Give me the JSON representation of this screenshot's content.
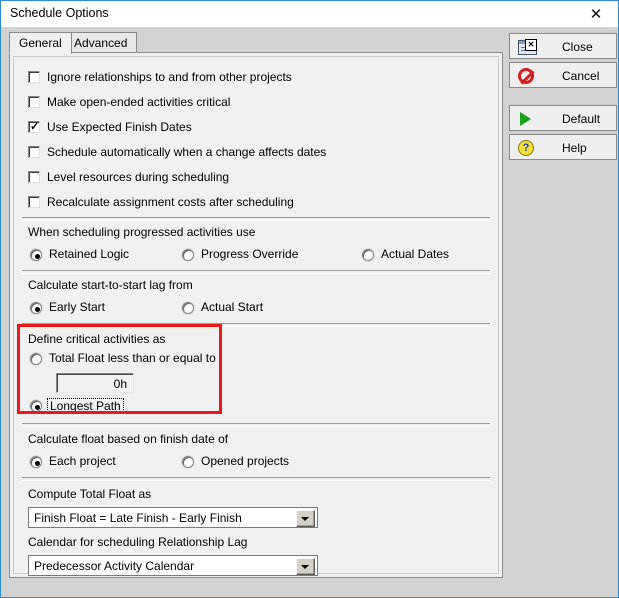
{
  "window": {
    "title": "Schedule Options",
    "close_icon": "close-icon"
  },
  "tabs": [
    {
      "label": "General",
      "active": true
    },
    {
      "label": "Advanced",
      "active": false
    }
  ],
  "checkboxes": [
    {
      "label": "Ignore relationships to and from other projects",
      "checked": false
    },
    {
      "label": "Make open-ended activities critical",
      "checked": false
    },
    {
      "label": "Use Expected Finish Dates",
      "checked": true
    },
    {
      "label": "Schedule automatically when a change affects dates",
      "checked": false
    },
    {
      "label": "Level resources during scheduling",
      "checked": false
    },
    {
      "label": "Recalculate assignment costs after scheduling",
      "checked": false
    }
  ],
  "groups": {
    "progressed": {
      "label": "When scheduling progressed activities use",
      "options": [
        {
          "label": "Retained Logic",
          "selected": true
        },
        {
          "label": "Progress Override",
          "selected": false
        },
        {
          "label": "Actual Dates",
          "selected": false
        }
      ]
    },
    "lag": {
      "label": "Calculate start-to-start lag from",
      "options": [
        {
          "label": "Early Start",
          "selected": true
        },
        {
          "label": "Actual Start",
          "selected": false
        }
      ]
    },
    "critical": {
      "label": "Define critical activities as",
      "total_float_option": "Total Float less than or equal to",
      "total_float_selected": false,
      "float_value": "0h",
      "longest_path_option": "Longest Path",
      "longest_path_selected": true,
      "highlight_color": "#e81919"
    },
    "float_basis": {
      "label": "Calculate float based on finish date of",
      "options": [
        {
          "label": "Each project",
          "selected": true
        },
        {
          "label": "Opened projects",
          "selected": false
        }
      ]
    },
    "total_float": {
      "label": "Compute Total Float as",
      "value": "Finish Float = Late Finish - Early Finish"
    },
    "calendar": {
      "label": "Calendar for scheduling Relationship Lag",
      "value": "Predecessor Activity Calendar"
    }
  },
  "buttons": [
    {
      "label": "Close",
      "icon": "window-close-icon"
    },
    {
      "label": "Cancel",
      "icon": "prohibition-icon"
    },
    {
      "label": "Default",
      "icon": "play-triangle-icon"
    },
    {
      "label": "Help",
      "icon": "question-mark-icon"
    }
  ]
}
